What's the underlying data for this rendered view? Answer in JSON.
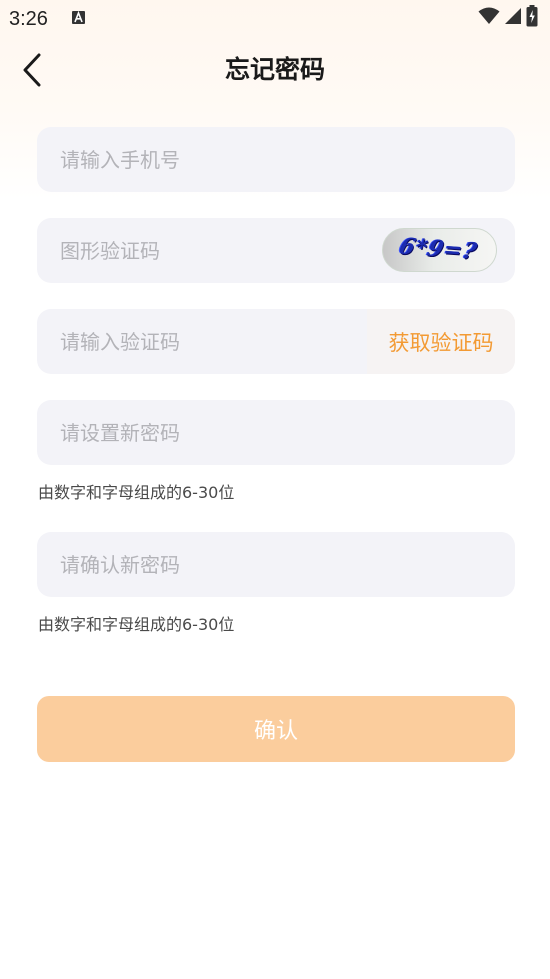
{
  "status_bar": {
    "time": "3:26"
  },
  "header": {
    "title": "忘记密码",
    "back_icon": "chevron-left-icon"
  },
  "form": {
    "phone": {
      "placeholder": "请输入手机号",
      "value": ""
    },
    "image_code": {
      "placeholder": "图形验证码",
      "value": "",
      "captcha_text": "6*9=?"
    },
    "sms_code": {
      "placeholder": "请输入验证码",
      "value": "",
      "get_code_label": "获取验证码"
    },
    "new_password": {
      "placeholder": "请设置新密码",
      "value": "",
      "hint": "由数字和字母组成的6-30位"
    },
    "confirm_password": {
      "placeholder": "请确认新密码",
      "value": "",
      "hint": "由数字和字母组成的6-30位"
    },
    "submit_label": "确认"
  },
  "colors": {
    "accent": "#f39a33",
    "button_bg": "#fbcd9d",
    "field_bg": "#f3f3f8",
    "placeholder": "#b3b3b8"
  }
}
